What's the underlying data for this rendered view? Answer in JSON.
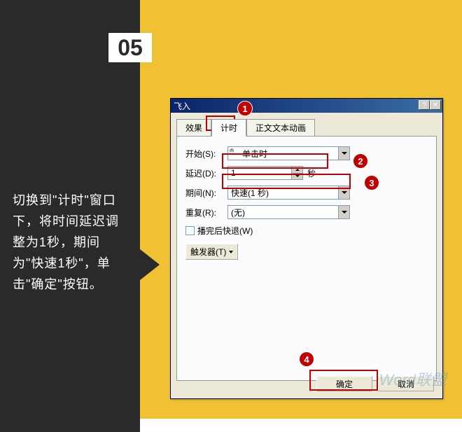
{
  "step": "05",
  "instruction": "切换到\"计时\"窗口下，将时间延迟调整为1秒，期间为\"快速1秒\"，单击\"确定\"按钮。",
  "dialog": {
    "title": "飞入",
    "tabs": {
      "effect": "效果",
      "timing": "计时",
      "text_anim": "正文文本动画"
    },
    "fields": {
      "start_label": "开始(S):",
      "start_value": "单击时",
      "delay_label": "延迟(D):",
      "delay_value": "1",
      "delay_unit": "秒",
      "period_label": "期间(N):",
      "period_value": "快速(1 秒)",
      "repeat_label": "重复(R):",
      "repeat_value": "(无)",
      "rewind_label": "播完后快退(W)",
      "trigger_label": "触发器(T)"
    },
    "buttons": {
      "ok": "确定",
      "cancel": "取消"
    }
  },
  "callouts": {
    "c1": "1",
    "c2": "2",
    "c3": "3",
    "c4": "4"
  },
  "watermark": "Word联盟"
}
